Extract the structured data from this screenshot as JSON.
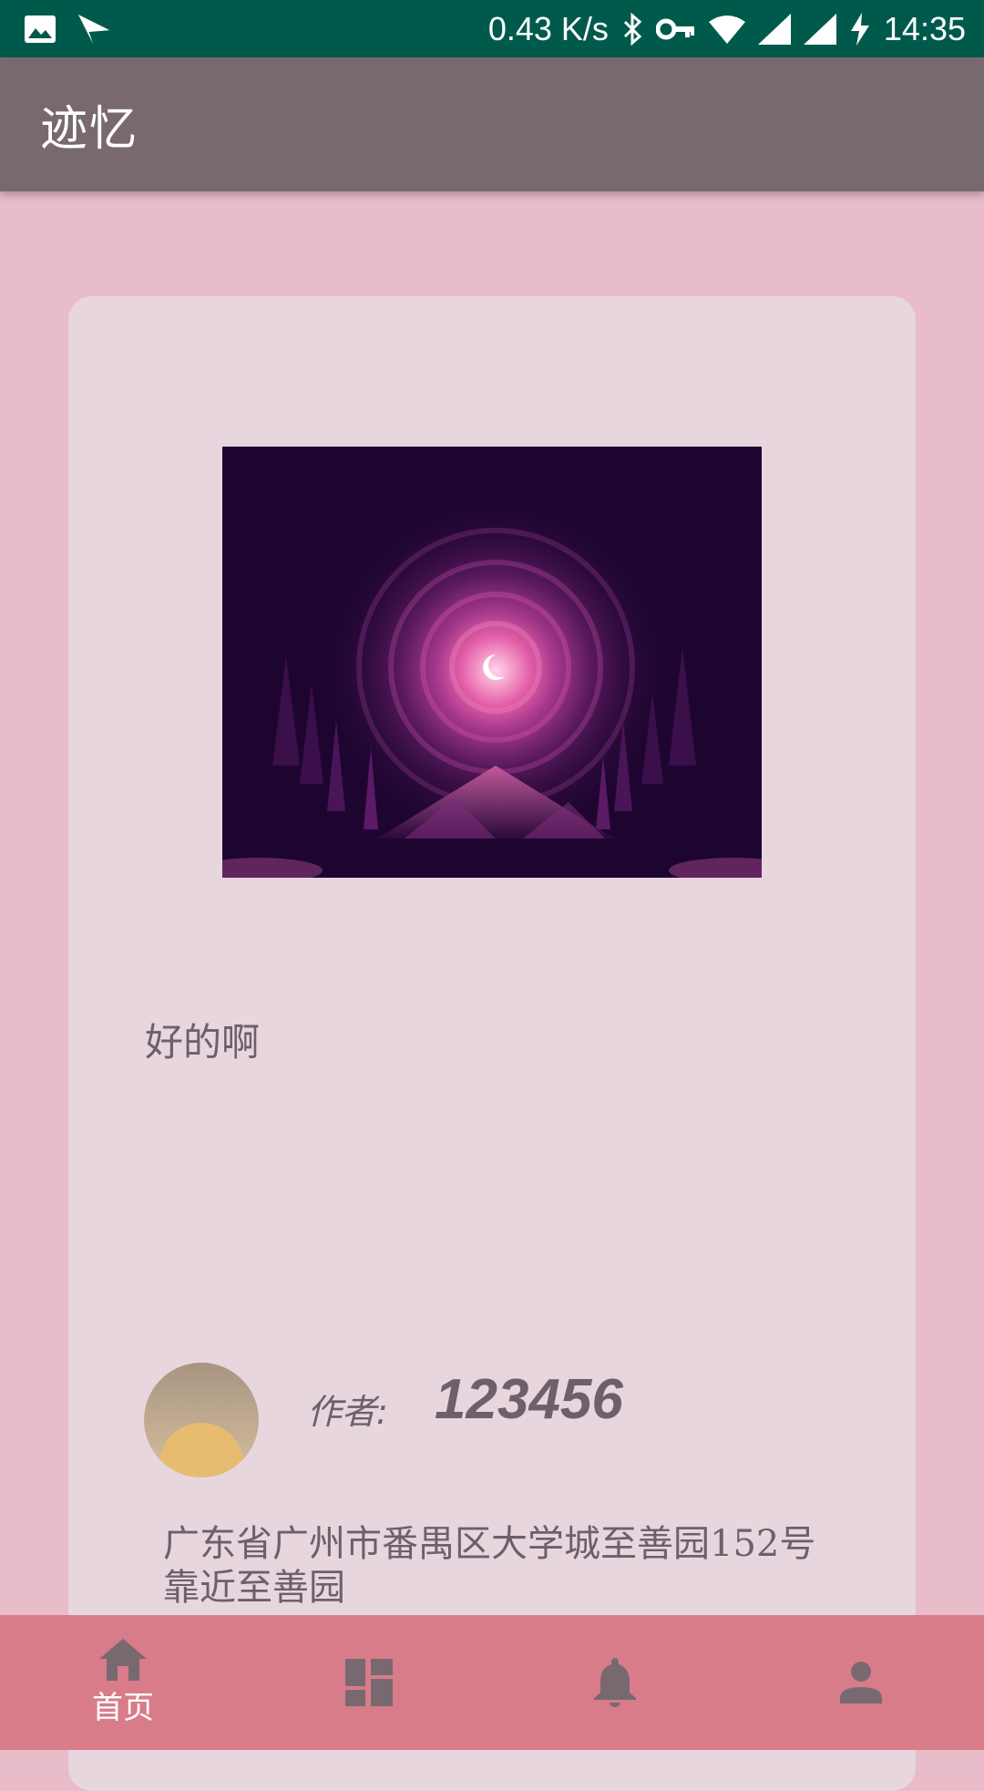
{
  "status_bar": {
    "net_speed": "0.43 K/s",
    "time": "14:35",
    "icons": [
      "image-icon",
      "send-icon",
      "bluetooth-icon",
      "key-icon",
      "wifi-icon",
      "signal-icon",
      "signal-icon",
      "charging-icon"
    ]
  },
  "app_bar": {
    "title": "迹忆"
  },
  "post": {
    "image_alt": "purple night landscape with pink moon",
    "text": "好的啊",
    "author_label": "作者:",
    "author_name": "123456",
    "location": "广东省广州市番禺区大学城至善园152号靠近至善园"
  },
  "bottom_nav": {
    "items": [
      {
        "icon": "home-icon",
        "label": "首页",
        "active": true
      },
      {
        "icon": "dashboard-icon",
        "label": "",
        "active": false
      },
      {
        "icon": "bell-icon",
        "label": "",
        "active": false
      },
      {
        "icon": "person-icon",
        "label": "",
        "active": false
      }
    ]
  },
  "colors": {
    "status_bar": "#005a4c",
    "app_bar": "#786971",
    "background": "#e8bcc9",
    "card": "#e8d6df",
    "bottom_nav": "#d87c8a"
  }
}
